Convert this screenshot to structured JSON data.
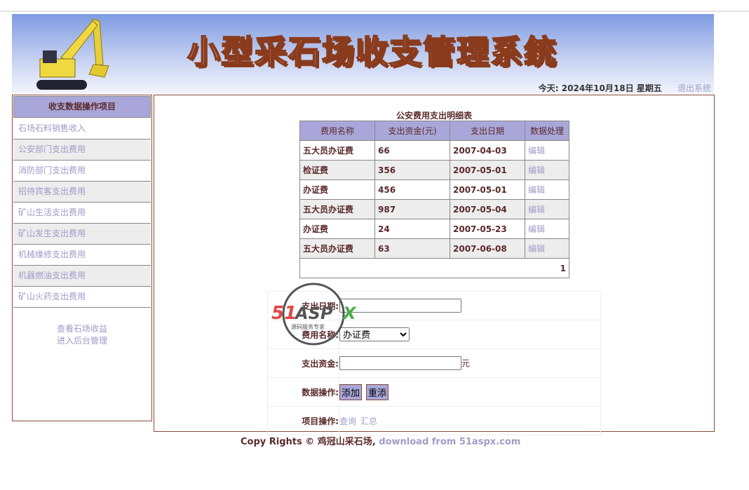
{
  "header": {
    "title": "小型采石场收支管理系统",
    "today_label": "今天:",
    "date": "2024年10月18日",
    "weekday": "星期五",
    "logout": "退出系统"
  },
  "sidebar": {
    "title": "收支数据操作项目",
    "items": [
      {
        "label": "石场石料销售收入"
      },
      {
        "label": "公安部门支出费用"
      },
      {
        "label": "消防部门支出费用"
      },
      {
        "label": "招待宾客支出费用"
      },
      {
        "label": "矿山生活支出费用"
      },
      {
        "label": "矿山发生支出费用"
      },
      {
        "label": "机械维修支出费用"
      },
      {
        "label": "机器燃油支出费用"
      },
      {
        "label": "矿山火药支出费用"
      }
    ],
    "links": [
      "查看石场收益",
      "进入后台管理"
    ]
  },
  "table": {
    "caption": "公安费用支出明细表",
    "headers": [
      "费用名称",
      "支出资金(元)",
      "支出日期",
      "数据处理"
    ],
    "rows": [
      [
        "五大员办证费",
        "66",
        "2007-04-03",
        "编辑"
      ],
      [
        "检证费",
        "356",
        "2007-05-01",
        "编辑"
      ],
      [
        "办证费",
        "456",
        "2007-05-01",
        "编辑"
      ],
      [
        "五大员办证费",
        "987",
        "2007-05-04",
        "编辑"
      ],
      [
        "办证费",
        "24",
        "2007-05-23",
        "编辑"
      ],
      [
        "五大员办证费",
        "63",
        "2007-06-08",
        "编辑"
      ]
    ],
    "page": "1"
  },
  "form": {
    "date_label": "支出日期:",
    "date_value": "",
    "name_label": "费用名称:",
    "name_selected": "办证费",
    "amount_label": "支出资金:",
    "amount_value": "",
    "amount_unit": "元",
    "ops_label": "数据操作:",
    "add": "添加",
    "reset": "重添",
    "item_label": "项目操作:",
    "query": "查询",
    "summary": "汇总"
  },
  "watermark": {
    "text": "51ASPX",
    "sub": "源码服务专家"
  },
  "footer": {
    "text": "Copy Rights © 鸡冠山采石场,",
    "link": "download from 51aspx.com"
  }
}
